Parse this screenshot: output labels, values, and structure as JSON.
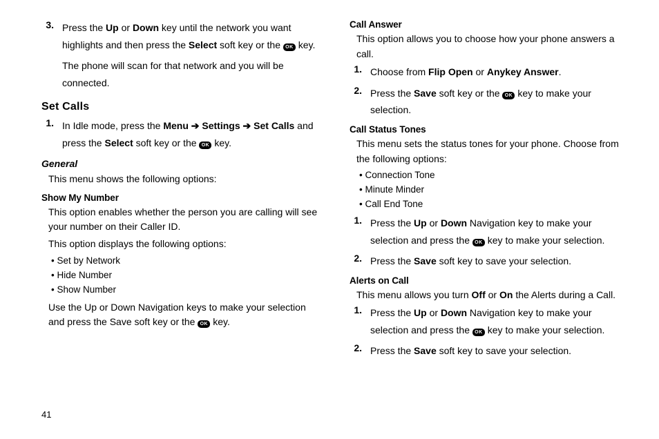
{
  "page_number": "41",
  "ok_label": "OK",
  "left": {
    "step3": {
      "num": "3.",
      "part1": "Press the ",
      "b1": "Up",
      "part2": " or ",
      "b2": "Down",
      "part3": " key until the network you want highlights and then press the ",
      "b3": "Select",
      "part4": " soft key or the ",
      "part5": " key."
    },
    "step3_follow": "The phone will scan for that network and you will be connected.",
    "h2_set_calls": "Set Calls",
    "sc_step1": {
      "num": "1.",
      "part1": "In Idle mode, press the ",
      "b1": "Menu",
      "arr1": " ➔ ",
      "b2": "Settings",
      "arr2": " ➔ ",
      "b3": "Set Calls",
      "part2": " and press the ",
      "b4": "Select",
      "part3": " soft key or the ",
      "part4": " key."
    },
    "h3_general": "General",
    "general_intro": "This menu shows the following options:",
    "h4_show_my_number": "Show My Number",
    "smn_p1": "This option enables whether the person you are calling will see your number on their Caller ID.",
    "smn_p2": "This option displays the following options:",
    "smn_bullets": [
      "Set by Network",
      "Hide Number",
      "Show Number"
    ],
    "smn_p3a": "Use the Up or Down Navigation keys to make your selection and press the Save soft key or the ",
    "smn_p3b": " key."
  },
  "right": {
    "h4_call_answer": "Call Answer",
    "ca_intro": "This option allows you to choose how your phone answers a call.",
    "ca_step1": {
      "num": "1.",
      "part1": "Choose from ",
      "b1": "Flip Open",
      "part2": " or ",
      "b2": "Anykey Answer",
      "part3": "."
    },
    "ca_step2": {
      "num": "2.",
      "part1": "Press the ",
      "b1": "Save",
      "part2": " soft key or the ",
      "part3": " key to make your selection."
    },
    "h4_call_status": "Call Status Tones",
    "cst_intro": "This menu sets the status tones for your phone. Choose from the following options:",
    "cst_bullets": [
      "Connection Tone",
      "Minute Minder",
      "Call End Tone"
    ],
    "cst_step1": {
      "num": "1.",
      "part1": "Press the ",
      "b1": "Up",
      "part2": " or ",
      "b2": "Down",
      "part3": " Navigation key to make your selection and press the ",
      "part4": " key to make your selection."
    },
    "cst_step2": {
      "num": "2.",
      "part1": "Press the ",
      "b1": "Save",
      "part2": " soft key to save your selection."
    },
    "h4_alerts": "Alerts on Call",
    "al_intro_a": "This menu allows you turn ",
    "al_b1": "Off",
    "al_intro_b": " or ",
    "al_b2": "On",
    "al_intro_c": " the Alerts during a Call.",
    "al_step1": {
      "num": "1.",
      "part1": "Press the ",
      "b1": "Up",
      "part2": " or ",
      "b2": "Down",
      "part3": " Navigation key to make your selection and press the ",
      "part4": " key to make your selection."
    },
    "al_step2": {
      "num": "2.",
      "part1": "Press the ",
      "b1": "Save",
      "part2": " soft key to save your selection."
    }
  }
}
